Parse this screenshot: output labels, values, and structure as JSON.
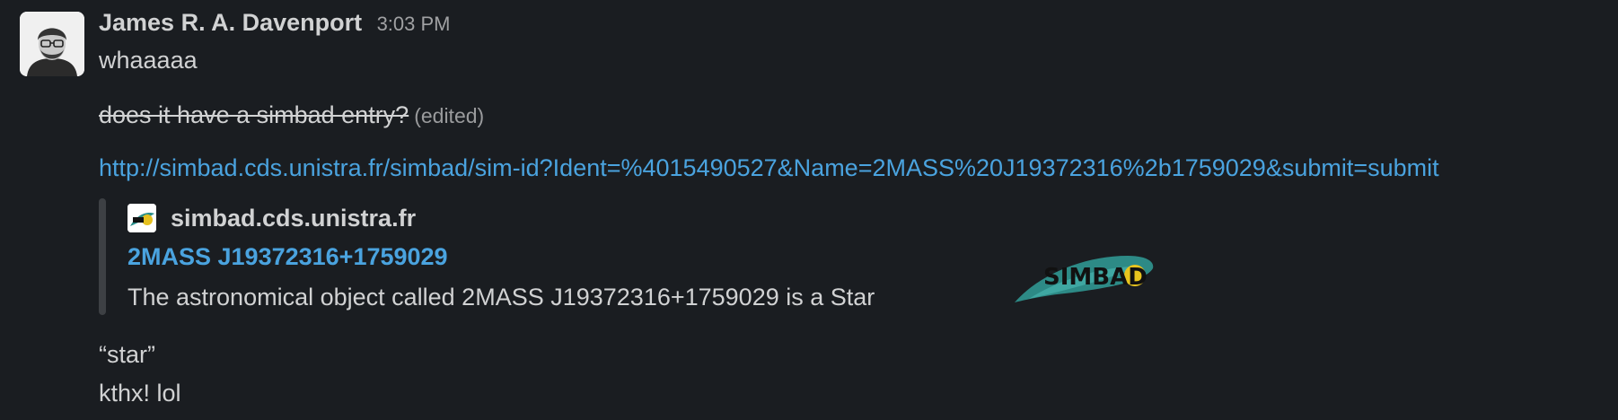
{
  "message": {
    "author": "James R. A. Davenport",
    "timestamp": "3:03 PM",
    "lines": [
      "whaaaaa",
      "does it have a simbad entry?",
      "“star”",
      "kthx! lol"
    ],
    "edited_label": "(edited)",
    "link_url": "http://simbad.cds.unistra.fr/simbad/sim-id?Ident=%4015490527&Name=2MASS%20J19372316%2b1759029&submit=submit"
  },
  "unfurl": {
    "site": "simbad.cds.unistra.fr",
    "title": "2MASS J19372316+1759029",
    "description": "The astronomical object called 2MASS J19372316+1759029 is a Star",
    "thumbnail_text": "SIMBAD"
  },
  "colors": {
    "background": "#1a1d21",
    "text": "#d1d2d3",
    "link": "#4aa3df",
    "muted": "#9a9b9d"
  }
}
